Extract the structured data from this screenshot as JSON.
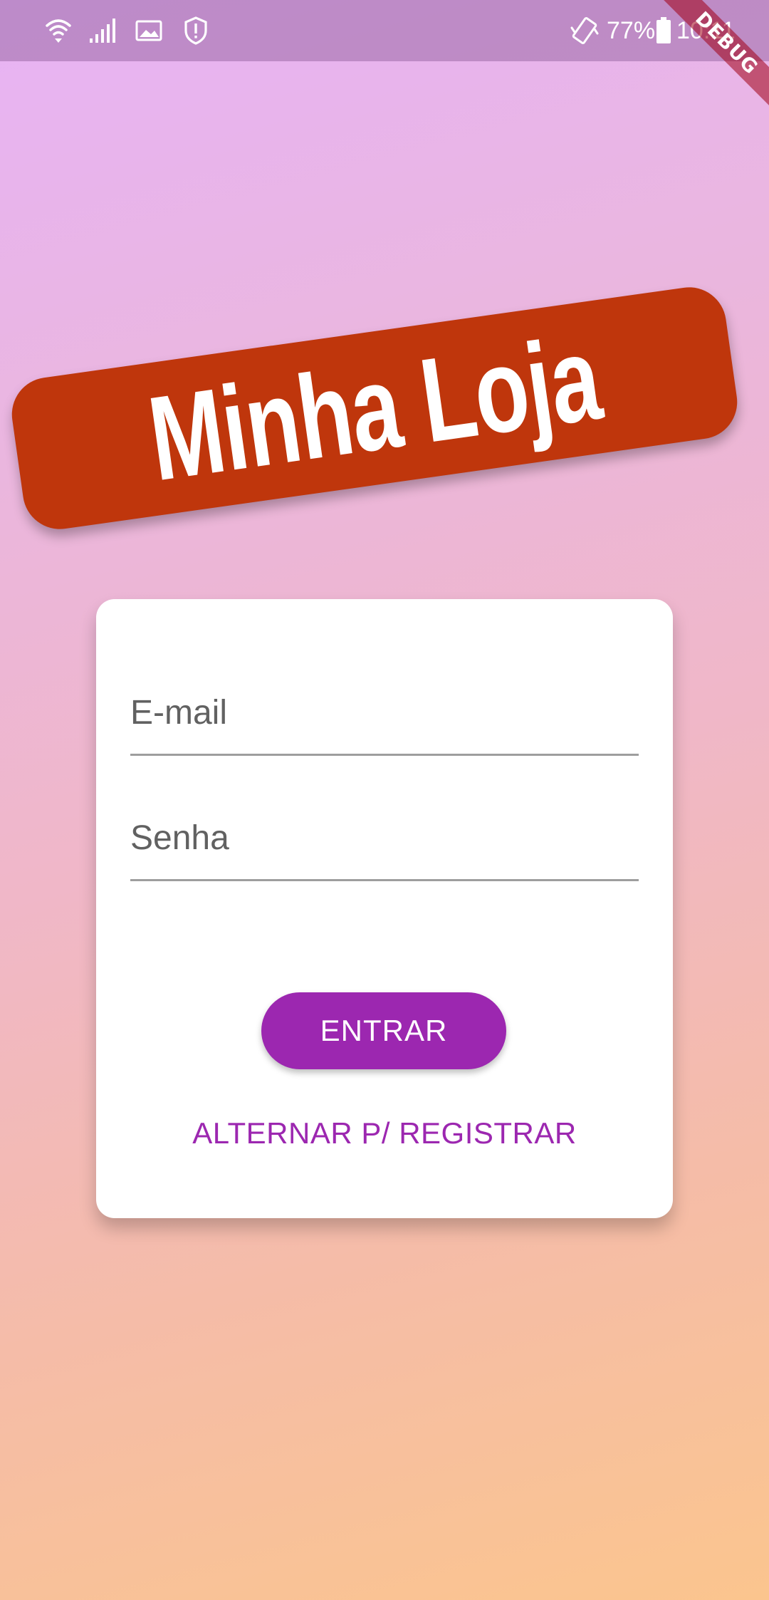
{
  "status_bar": {
    "icons": [
      "wifi-icon",
      "signal-icon",
      "image-icon",
      "shield-alert-icon",
      "vibrate-icon",
      "battery-icon"
    ],
    "battery_percent": "77%",
    "time": "10:11"
  },
  "debug_banner": {
    "label": "DEBUG"
  },
  "banner": {
    "title": "Minha Loja",
    "color": "#bf360c"
  },
  "form": {
    "email": {
      "placeholder": "E-mail",
      "value": ""
    },
    "password": {
      "placeholder": "Senha",
      "value": ""
    },
    "submit_label": "ENTRAR",
    "switch_label": "ALTERNAR P/ REGISTRAR"
  },
  "colors": {
    "accent": "#9c27b0",
    "gradient_top": "#e7b3f5",
    "gradient_bottom": "#fbc58e",
    "card": "#ffffff"
  }
}
